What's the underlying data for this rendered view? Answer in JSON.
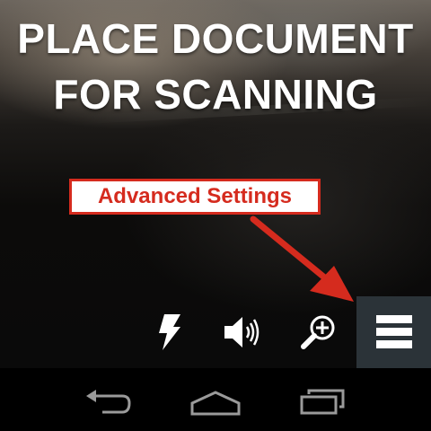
{
  "headline": {
    "line1": "PLACE DOCUMENT",
    "line2": "FOR SCANNING"
  },
  "callout": {
    "label": "Advanced Settings",
    "color": "#d52b1e"
  },
  "camera_controls": {
    "icons": [
      "flash-icon",
      "volume-icon",
      "zoom-in-icon",
      "menu-icon"
    ],
    "menu_background": "#2b3338"
  },
  "navigation_bar": {
    "icons": [
      "back-icon",
      "home-icon",
      "recent-apps-icon"
    ]
  }
}
